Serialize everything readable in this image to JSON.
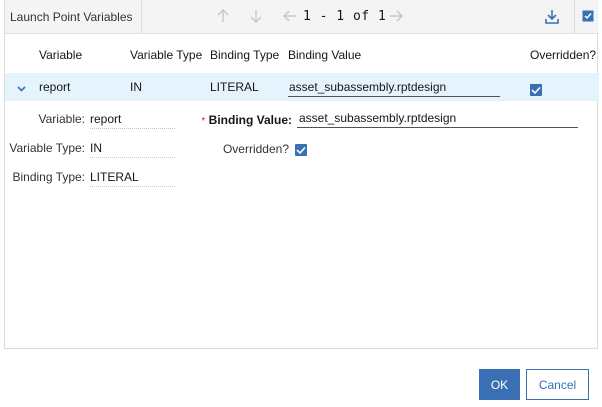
{
  "toolbar": {
    "title": "Launch Point Variables",
    "pager": "1 - 1 of 1"
  },
  "table": {
    "columns": [
      "Variable",
      "Variable Type",
      "Binding Type",
      "Binding Value",
      "Overridden?"
    ],
    "row": {
      "variable": "report",
      "variable_type": "IN",
      "binding_type": "LITERAL",
      "binding_value": "asset_subassembly.rptdesign",
      "overridden": true
    }
  },
  "details": {
    "variable_label": "Variable:",
    "variable_value": "report",
    "variable_type_label": "Variable Type:",
    "variable_type_value": "IN",
    "binding_type_label": "Binding Type:",
    "binding_type_value": "LITERAL",
    "required_marker": "*",
    "binding_value_label": "Binding Value:",
    "binding_value_value": "asset_subassembly.rptdesign",
    "overridden_label": "Overridden?",
    "overridden_value": true
  },
  "footer": {
    "ok_label": "OK",
    "cancel_label": "Cancel"
  },
  "colors": {
    "accent": "#3b6fb4",
    "row_highlight": "#e5f3fc",
    "required": "#da1e28"
  }
}
